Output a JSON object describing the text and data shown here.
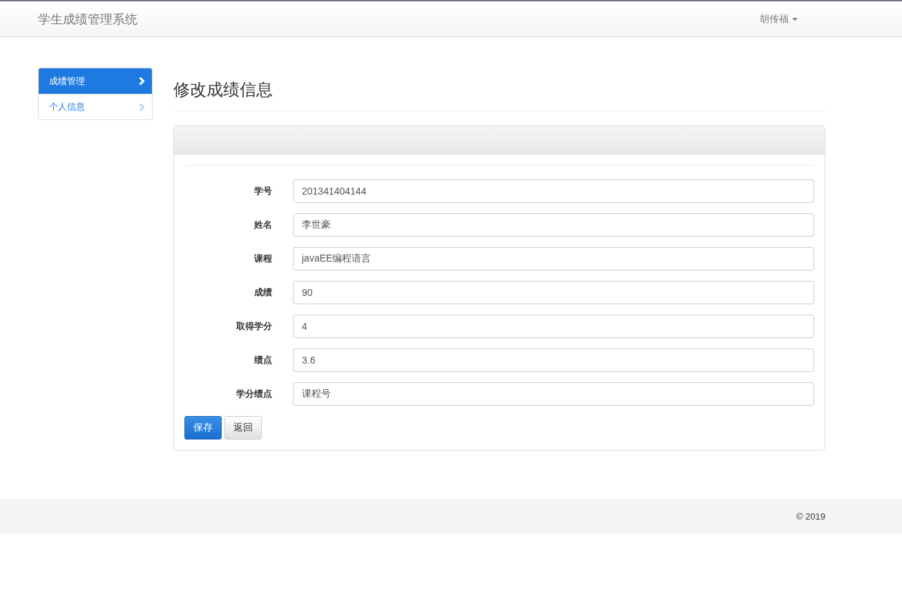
{
  "navbar": {
    "brand": "学生成绩管理系统",
    "user_menu": "胡传福"
  },
  "sidebar": {
    "items": [
      {
        "label": "成绩管理",
        "selected": true
      },
      {
        "label": "个人信息",
        "selected": false
      }
    ]
  },
  "page_title": "修改成绩信息",
  "form": {
    "fields": [
      {
        "label": "学号",
        "value": "201341404144"
      },
      {
        "label": "姓名",
        "value": "李世豪"
      },
      {
        "label": "课程",
        "value": "javaEE编程语言"
      },
      {
        "label": "成绩",
        "value": "90"
      },
      {
        "label": "取得学分",
        "value": "4"
      },
      {
        "label": "绩点",
        "value": "3.6"
      },
      {
        "label": "学分绩点",
        "value": "课程号"
      }
    ],
    "buttons": [
      {
        "label": "保存",
        "kind": "primary"
      },
      {
        "label": "返回",
        "kind": "default"
      }
    ]
  },
  "footer": {
    "copyright": "© 2019"
  }
}
